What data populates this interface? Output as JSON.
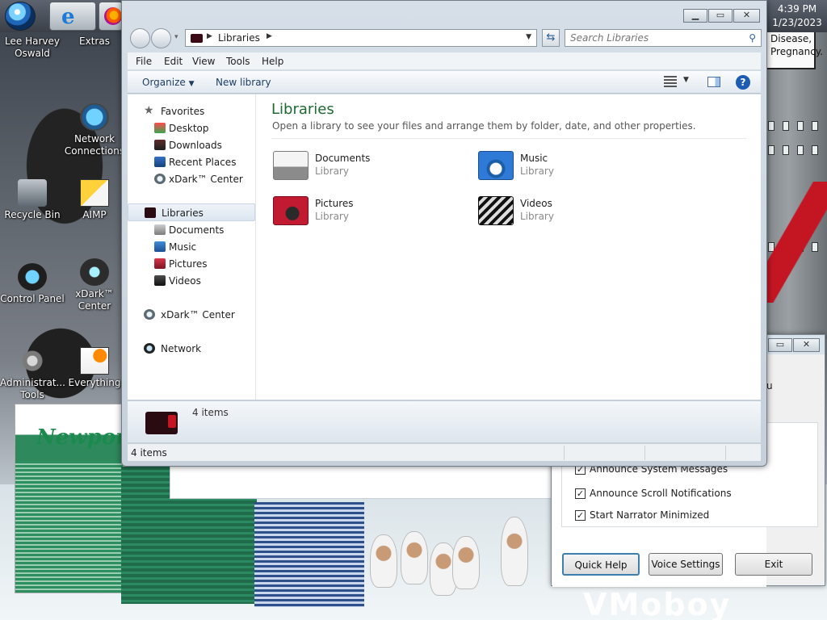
{
  "clock": {
    "time": "4:39 PM",
    "date": "1/23/2023"
  },
  "sign": {
    "line1": "Disease,",
    "line2": "Pregnancy."
  },
  "brand_text": "Newport",
  "desktop_bottom_text": "VMoboy",
  "desktop_icons": [
    {
      "label": "Lee Harvey Oswald",
      "icon": "avatar-icon"
    },
    {
      "label": "Extras",
      "icon": "folder-icon"
    },
    {
      "label": "Network Connections",
      "icon": "network-icon"
    },
    {
      "label": "Recycle Bin",
      "icon": "recycle-bin-icon"
    },
    {
      "label": "AIMP",
      "icon": "aimp-icon"
    },
    {
      "label": "Control Panel",
      "icon": "control-panel-icon"
    },
    {
      "label": "xDark™ Center",
      "icon": "xdark-icon"
    },
    {
      "label": "Administrat... Tools",
      "icon": "admin-tools-icon"
    },
    {
      "label": "Everything",
      "icon": "everything-icon"
    }
  ],
  "explorer": {
    "address": {
      "crumb": "Libraries"
    },
    "search_placeholder": "Search Libraries",
    "menu": [
      "File",
      "Edit",
      "View",
      "Tools",
      "Help"
    ],
    "toolbar": {
      "organize": "Organize",
      "new_library": "New library"
    },
    "nav": {
      "favorites": "Favorites",
      "desktop": "Desktop",
      "downloads": "Downloads",
      "recent_places": "Recent Places",
      "xdark_fav": "xDark™ Center",
      "libraries": "Libraries",
      "documents": "Documents",
      "music": "Music",
      "pictures": "Pictures",
      "videos": "Videos",
      "xdark_center": "xDark™ Center",
      "network": "Network"
    },
    "main": {
      "title": "Libraries",
      "subtitle": "Open a library to see your files and arrange them by folder, date, and other properties.",
      "tiles": [
        {
          "name": "Documents",
          "type": "Library"
        },
        {
          "name": "Music",
          "type": "Library"
        },
        {
          "name": "Pictures",
          "type": "Library"
        },
        {
          "name": "Videos",
          "type": "Library"
        }
      ]
    },
    "details_count": "4 items",
    "status": "4 items"
  },
  "narrator": {
    "options": [
      {
        "label": "Announce System Messages",
        "checked": true
      },
      {
        "label": "Announce Scroll Notifications",
        "checked": true
      },
      {
        "label": "Start Narrator Minimized",
        "checked": true
      }
    ],
    "buttons": {
      "quick_help": "Quick Help",
      "voice_settings": "Voice Settings",
      "exit": "Exit"
    },
    "partial_text": "u"
  }
}
